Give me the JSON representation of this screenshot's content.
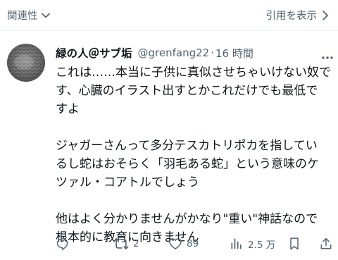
{
  "topbar": {
    "relevance_label": "関連性",
    "quote_label": "引用を表示"
  },
  "post": {
    "display_name": "緑の人＠サブ垢",
    "handle": "@grenfang22",
    "separator": "·",
    "time": "16 時間",
    "paragraphs": [
      [
        "これは……本当に子供に真似させちゃいけない奴で",
        "す、心臓のイラスト出すとかこれだけでも最低で",
        "すよ"
      ],
      [
        "ジャガーさんって多分テスカトリポカを指してい",
        "るし蛇はおそらく「羽毛ある蛇」という意味のケ",
        "ツァル・コアトルでしょう"
      ],
      [
        "他はよく分かりませんがかなり\"重い\"神話なので",
        "根本的に教育に向きません"
      ]
    ],
    "actions": {
      "retweet_count": "2",
      "like_count": "89",
      "view_count": "2.5 万"
    }
  },
  "colors": {
    "text": "#0f1419",
    "muted": "#536471",
    "border": "#eff3f4"
  },
  "icons": [
    "chevron-down-icon",
    "chevron-right-icon",
    "more-icon",
    "reply-icon",
    "retweet-icon",
    "like-icon",
    "views-icon",
    "bookmark-icon",
    "share-icon"
  ]
}
